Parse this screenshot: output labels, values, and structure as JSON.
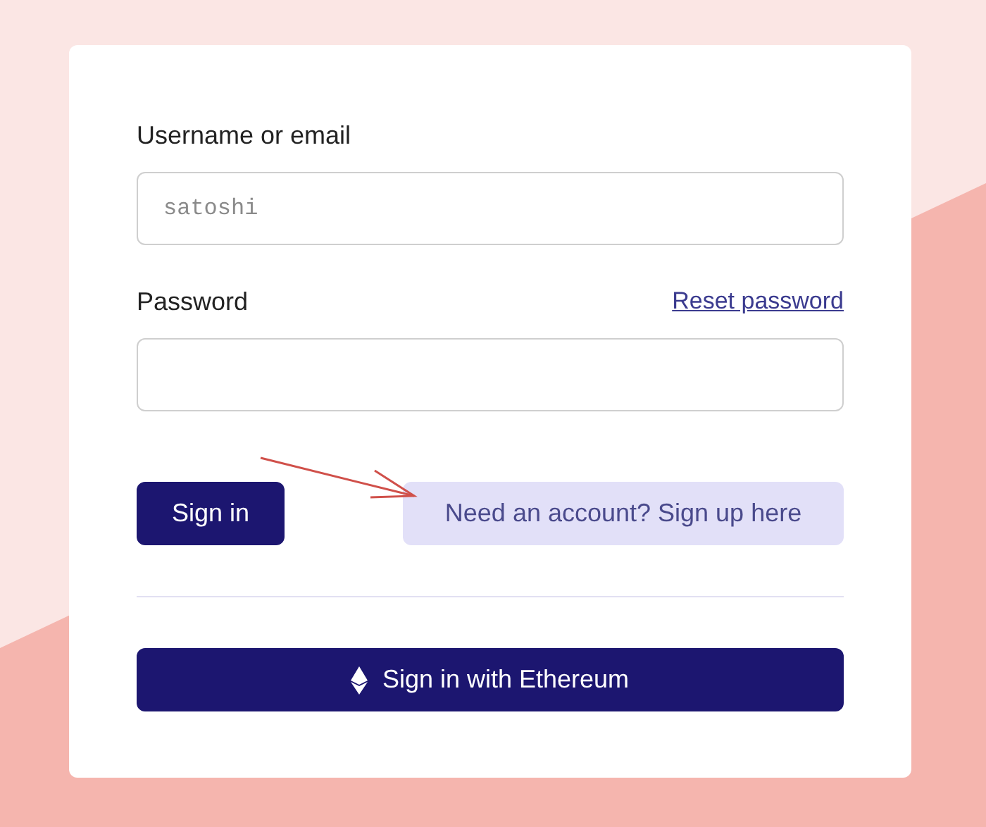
{
  "login_form": {
    "username": {
      "label": "Username or email",
      "placeholder": "satoshi"
    },
    "password": {
      "label": "Password",
      "reset_link": "Reset password"
    },
    "sign_in_button": "Sign in",
    "sign_up_button": "Need an account? Sign up here",
    "ethereum_button": "Sign in with Ethereum"
  }
}
